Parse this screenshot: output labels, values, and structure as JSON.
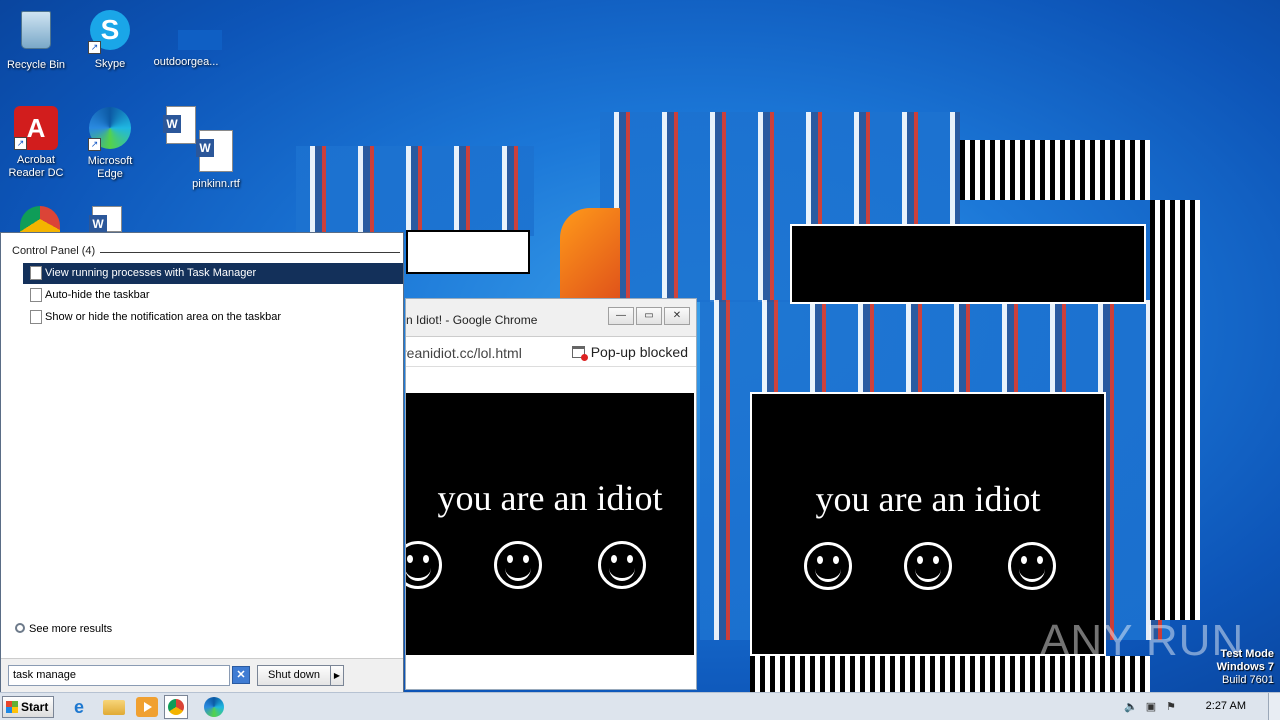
{
  "desktop": {
    "icons": [
      {
        "label": "Recycle Bin",
        "icon": "recycle-bin-icon"
      },
      {
        "label": "Skype",
        "icon": "skype-icon"
      },
      {
        "label": "outdoorgea...",
        "icon": "file-icon"
      },
      {
        "label": "Acrobat Reader DC",
        "icon": "acrobat-icon"
      },
      {
        "label": "Microsoft Edge",
        "icon": "edge-icon"
      },
      {
        "label": "pinkinn.rtf",
        "icon": "word-document-icon"
      }
    ]
  },
  "chrome_window": {
    "title": "n Idiot! - Google Chrome",
    "url": "reanidiot.cc/lol.html",
    "popup_blocked": "Pop-up blocked",
    "page_text": "you are an idiot"
  },
  "idiot_window": {
    "text": "you are an idiot"
  },
  "start_menu": {
    "group_header": "Control Panel (4)",
    "items": [
      {
        "label": "View running processes with Task Manager",
        "selected": true
      },
      {
        "label": "Auto-hide the taskbar",
        "selected": false
      },
      {
        "label": "Show or hide the notification area on the taskbar",
        "selected": false
      }
    ],
    "see_more": "See more results",
    "search_value": "task manage",
    "shutdown_label": "Shut down"
  },
  "watermark": "ANY RUN",
  "test_mode": {
    "line1": "Test Mode",
    "line2": "Windows 7",
    "line3": "Build 7601"
  },
  "taskbar": {
    "start_label": "Start",
    "clock": "2:27 AM",
    "pinned": [
      "internet-explorer-icon",
      "folder-icon",
      "media-player-icon",
      "chrome-icon",
      "edge-icon"
    ]
  },
  "colors": {
    "selection": "#13305a",
    "desktop": "#1c78d8"
  }
}
